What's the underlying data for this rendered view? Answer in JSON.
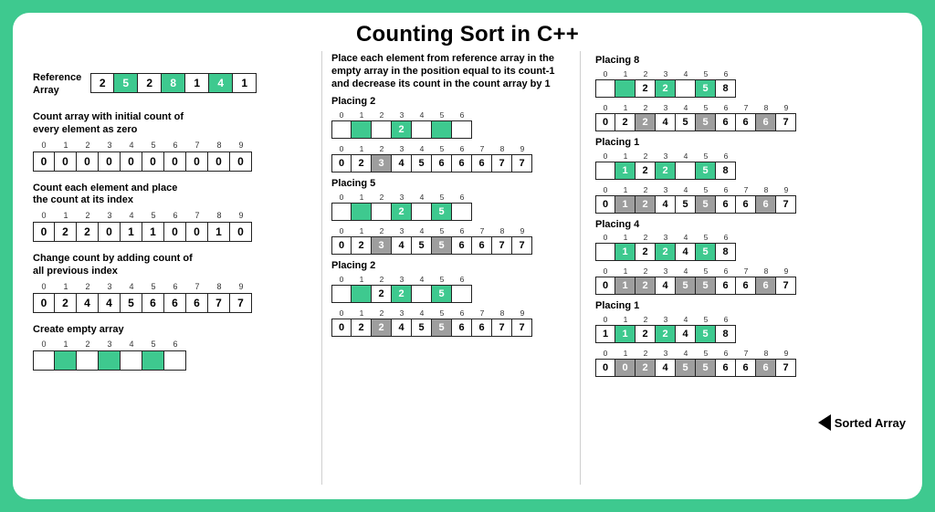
{
  "title": "Counting Sort in C++",
  "col1": {
    "ref_label": "Reference\nArray",
    "ref_cells": [
      {
        "v": "2"
      },
      {
        "v": "5",
        "c": "green"
      },
      {
        "v": "2"
      },
      {
        "v": "8",
        "c": "green"
      },
      {
        "v": "1"
      },
      {
        "v": "4",
        "c": "green"
      },
      {
        "v": "1"
      }
    ],
    "step1_caption": "Count array with initial count of\nevery element as zero",
    "step1_idx": [
      "0",
      "1",
      "2",
      "3",
      "4",
      "5",
      "6",
      "7",
      "8",
      "9"
    ],
    "step1_cells": [
      {
        "v": "0"
      },
      {
        "v": "0"
      },
      {
        "v": "0"
      },
      {
        "v": "0"
      },
      {
        "v": "0"
      },
      {
        "v": "0"
      },
      {
        "v": "0"
      },
      {
        "v": "0"
      },
      {
        "v": "0"
      },
      {
        "v": "0"
      }
    ],
    "step2_caption": "Count each element and place\nthe count at its index",
    "step2_idx": [
      "0",
      "1",
      "2",
      "3",
      "4",
      "5",
      "6",
      "7",
      "8",
      "9"
    ],
    "step2_cells": [
      {
        "v": "0"
      },
      {
        "v": "2"
      },
      {
        "v": "2"
      },
      {
        "v": "0"
      },
      {
        "v": "1"
      },
      {
        "v": "1"
      },
      {
        "v": "0"
      },
      {
        "v": "0"
      },
      {
        "v": "1"
      },
      {
        "v": "0"
      }
    ],
    "step3_caption": "Change count by adding count of\nall previous index",
    "step3_idx": [
      "0",
      "1",
      "2",
      "3",
      "4",
      "5",
      "6",
      "7",
      "8",
      "9"
    ],
    "step3_cells": [
      {
        "v": "0"
      },
      {
        "v": "2"
      },
      {
        "v": "4"
      },
      {
        "v": "4"
      },
      {
        "v": "5"
      },
      {
        "v": "6"
      },
      {
        "v": "6"
      },
      {
        "v": "6"
      },
      {
        "v": "7"
      },
      {
        "v": "7"
      }
    ],
    "step4_caption": "Create empty array",
    "step4_idx": [
      "0",
      "1",
      "2",
      "3",
      "4",
      "5",
      "6"
    ],
    "step4_cells": [
      {
        "v": " "
      },
      {
        "v": " ",
        "c": "green"
      },
      {
        "v": " "
      },
      {
        "v": " ",
        "c": "green"
      },
      {
        "v": " "
      },
      {
        "v": " ",
        "c": "green"
      },
      {
        "v": " "
      }
    ]
  },
  "col2": {
    "intro": "Place each element from reference array in the empty array in the position equal to its count-1 and decrease its count in the count array  by 1",
    "groups": [
      {
        "label": "Placing 2",
        "out_idx": [
          "0",
          "1",
          "2",
          "3",
          "4",
          "5",
          "6"
        ],
        "out": [
          {
            "v": " "
          },
          {
            "v": " ",
            "c": "green"
          },
          {
            "v": " "
          },
          {
            "v": "2",
            "c": "green"
          },
          {
            "v": " "
          },
          {
            "v": " ",
            "c": "green"
          },
          {
            "v": " "
          }
        ],
        "cnt_idx": [
          "0",
          "1",
          "2",
          "3",
          "4",
          "5",
          "6",
          "7",
          "8",
          "9"
        ],
        "cnt": [
          {
            "v": "0"
          },
          {
            "v": "2"
          },
          {
            "v": "3",
            "c": "grey"
          },
          {
            "v": "4"
          },
          {
            "v": "5"
          },
          {
            "v": "6"
          },
          {
            "v": "6"
          },
          {
            "v": "6"
          },
          {
            "v": "7"
          },
          {
            "v": "7"
          }
        ]
      },
      {
        "label": "Placing 5",
        "out_idx": [
          "0",
          "1",
          "2",
          "3",
          "4",
          "5",
          "6"
        ],
        "out": [
          {
            "v": " "
          },
          {
            "v": " ",
            "c": "green"
          },
          {
            "v": " "
          },
          {
            "v": "2",
            "c": "green"
          },
          {
            "v": " "
          },
          {
            "v": "5",
            "c": "green"
          },
          {
            "v": " "
          }
        ],
        "cnt_idx": [
          "0",
          "1",
          "2",
          "3",
          "4",
          "5",
          "6",
          "7",
          "8",
          "9"
        ],
        "cnt": [
          {
            "v": "0"
          },
          {
            "v": "2"
          },
          {
            "v": "3",
            "c": "grey"
          },
          {
            "v": "4"
          },
          {
            "v": "5"
          },
          {
            "v": "5",
            "c": "grey"
          },
          {
            "v": "6"
          },
          {
            "v": "6"
          },
          {
            "v": "7"
          },
          {
            "v": "7"
          }
        ]
      },
      {
        "label": "Placing 2",
        "out_idx": [
          "0",
          "1",
          "2",
          "3",
          "4",
          "5",
          "6"
        ],
        "out": [
          {
            "v": " "
          },
          {
            "v": " ",
            "c": "green"
          },
          {
            "v": "2"
          },
          {
            "v": "2",
            "c": "green"
          },
          {
            "v": " "
          },
          {
            "v": "5",
            "c": "green"
          },
          {
            "v": " "
          }
        ],
        "cnt_idx": [
          "0",
          "1",
          "2",
          "3",
          "4",
          "5",
          "6",
          "7",
          "8",
          "9"
        ],
        "cnt": [
          {
            "v": "0"
          },
          {
            "v": "2"
          },
          {
            "v": "2",
            "c": "grey"
          },
          {
            "v": "4"
          },
          {
            "v": "5"
          },
          {
            "v": "5",
            "c": "grey"
          },
          {
            "v": "6"
          },
          {
            "v": "6"
          },
          {
            "v": "7"
          },
          {
            "v": "7"
          }
        ]
      }
    ]
  },
  "col3": {
    "groups": [
      {
        "label": "Placing 8",
        "out_idx": [
          "0",
          "1",
          "2",
          "3",
          "4",
          "5",
          "6"
        ],
        "out": [
          {
            "v": " "
          },
          {
            "v": " ",
            "c": "green"
          },
          {
            "v": "2"
          },
          {
            "v": "2",
            "c": "green"
          },
          {
            "v": " "
          },
          {
            "v": "5",
            "c": "green"
          },
          {
            "v": "8"
          }
        ],
        "cnt_idx": [
          "0",
          "1",
          "2",
          "3",
          "4",
          "5",
          "6",
          "7",
          "8",
          "9"
        ],
        "cnt": [
          {
            "v": "0"
          },
          {
            "v": "2"
          },
          {
            "v": "2",
            "c": "grey"
          },
          {
            "v": "4"
          },
          {
            "v": "5"
          },
          {
            "v": "5",
            "c": "grey"
          },
          {
            "v": "6"
          },
          {
            "v": "6"
          },
          {
            "v": "6",
            "c": "grey"
          },
          {
            "v": "7"
          }
        ]
      },
      {
        "label": "Placing 1",
        "out_idx": [
          "0",
          "1",
          "2",
          "3",
          "4",
          "5",
          "6"
        ],
        "out": [
          {
            "v": " "
          },
          {
            "v": "1",
            "c": "green"
          },
          {
            "v": "2"
          },
          {
            "v": "2",
            "c": "green"
          },
          {
            "v": " "
          },
          {
            "v": "5",
            "c": "green"
          },
          {
            "v": "8"
          }
        ],
        "cnt_idx": [
          "0",
          "1",
          "2",
          "3",
          "4",
          "5",
          "6",
          "7",
          "8",
          "9"
        ],
        "cnt": [
          {
            "v": "0"
          },
          {
            "v": "1",
            "c": "grey"
          },
          {
            "v": "2",
            "c": "grey"
          },
          {
            "v": "4"
          },
          {
            "v": "5"
          },
          {
            "v": "5",
            "c": "grey"
          },
          {
            "v": "6"
          },
          {
            "v": "6"
          },
          {
            "v": "6",
            "c": "grey"
          },
          {
            "v": "7"
          }
        ]
      },
      {
        "label": "Placing 4",
        "out_idx": [
          "0",
          "1",
          "2",
          "3",
          "4",
          "5",
          "6"
        ],
        "out": [
          {
            "v": " "
          },
          {
            "v": "1",
            "c": "green"
          },
          {
            "v": "2"
          },
          {
            "v": "2",
            "c": "green"
          },
          {
            "v": "4"
          },
          {
            "v": "5",
            "c": "green"
          },
          {
            "v": "8"
          }
        ],
        "cnt_idx": [
          "0",
          "1",
          "2",
          "3",
          "4",
          "5",
          "6",
          "7",
          "8",
          "9"
        ],
        "cnt": [
          {
            "v": "0"
          },
          {
            "v": "1",
            "c": "grey"
          },
          {
            "v": "2",
            "c": "grey"
          },
          {
            "v": "4"
          },
          {
            "v": "5",
            "c": "grey"
          },
          {
            "v": "5",
            "c": "grey"
          },
          {
            "v": "6"
          },
          {
            "v": "6"
          },
          {
            "v": "6",
            "c": "grey"
          },
          {
            "v": "7"
          }
        ]
      },
      {
        "label": "Placing 1",
        "out_idx": [
          "0",
          "1",
          "2",
          "3",
          "4",
          "5",
          "6"
        ],
        "out": [
          {
            "v": "1"
          },
          {
            "v": "1",
            "c": "green"
          },
          {
            "v": "2"
          },
          {
            "v": "2",
            "c": "green"
          },
          {
            "v": "4"
          },
          {
            "v": "5",
            "c": "green"
          },
          {
            "v": "8"
          }
        ],
        "cnt_idx": [
          "0",
          "1",
          "2",
          "3",
          "4",
          "5",
          "6",
          "7",
          "8",
          "9"
        ],
        "cnt": [
          {
            "v": "0"
          },
          {
            "v": "0",
            "c": "grey"
          },
          {
            "v": "2",
            "c": "grey"
          },
          {
            "v": "4"
          },
          {
            "v": "5",
            "c": "grey"
          },
          {
            "v": "5",
            "c": "grey"
          },
          {
            "v": "6"
          },
          {
            "v": "6"
          },
          {
            "v": "6",
            "c": "grey"
          },
          {
            "v": "7"
          }
        ]
      }
    ],
    "sorted_label": "Sorted Array"
  }
}
